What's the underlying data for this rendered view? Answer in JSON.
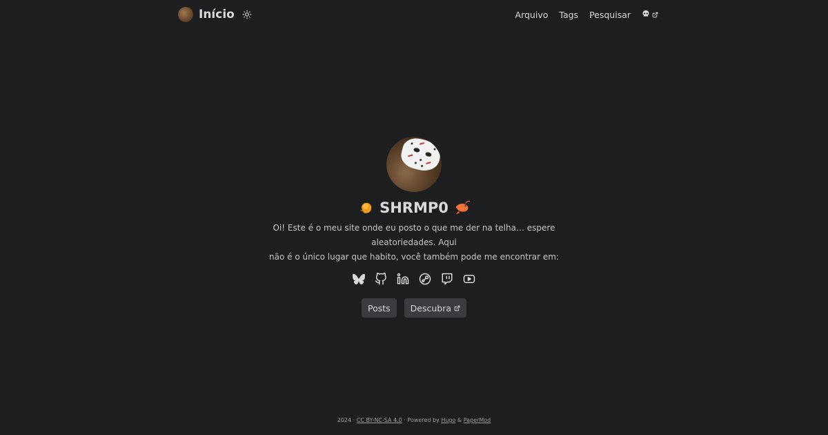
{
  "header": {
    "logo_text": "Início",
    "logo_icon": "avatar-image",
    "theme_icon": "sun-icon",
    "menu": [
      {
        "label": "Arquivo"
      },
      {
        "label": "Tags"
      },
      {
        "label": "Pesquisar"
      }
    ],
    "external_menu_icon": "skull-icon"
  },
  "profile": {
    "name": "SHRMP0",
    "emoji_left": "orange-shrimp-emoji",
    "emoji_right": "shrimp-emoji",
    "bio_line1": "Oi! Este é o meu site onde eu posto o que me der na telha… espere aleatoriedades. Aqui",
    "bio_line2": "não é o único lugar que habito, você também pode me encontrar em:",
    "social": [
      "bluesky-icon",
      "github-icon",
      "linkedin-icon",
      "steam-icon",
      "twitch-icon",
      "youtube-icon"
    ],
    "buttons": [
      {
        "label": "Posts"
      },
      {
        "label": "Descubra"
      }
    ]
  },
  "footer": {
    "year": "2024 ·",
    "license": "CC BY-NC-SA 4.0",
    "powered": "· Powered by",
    "hugo": "Hugo",
    "amp": "&",
    "papermod": "PaperMod"
  },
  "colors": {
    "background": "#1d1e20",
    "text": "#dadadb",
    "button": "#3b3c3f"
  }
}
